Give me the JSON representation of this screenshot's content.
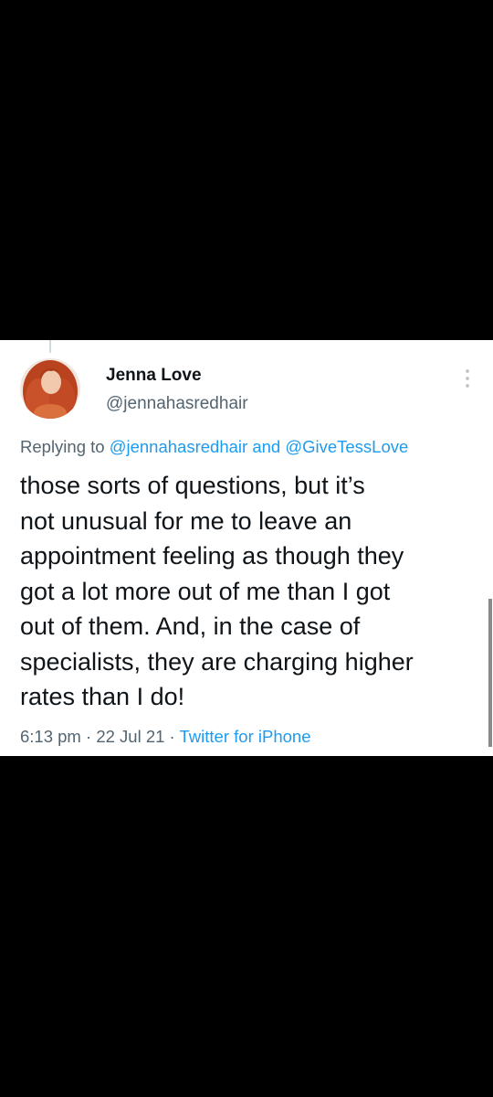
{
  "tweet": {
    "author": {
      "display_name": "Jenna Love",
      "handle": "@jennahasredhair",
      "avatar_icon": "profile-photo-red-hair"
    },
    "reply_prefix": "Replying to",
    "reply_to_1": "@jennahasredhair",
    "reply_joiner": "and",
    "reply_to_2": "@GiveTessLove",
    "text_lines": [
      "those sorts of questions, but it’s",
      "not unusual for me to leave an",
      "appointment feeling as though they",
      "got a lot more out of me than I got",
      "out of them. And, in the case of",
      "specialists, they are charging higher",
      "rates than I do!"
    ],
    "time": "6:13 pm",
    "separator": "·",
    "date": "22 Jul 21",
    "source": "Twitter for iPhone",
    "more_icon": "more-vertical-icon"
  },
  "colors": {
    "background": "#000000",
    "card": "#ffffff",
    "text": "#0f1419",
    "secondary": "#536471",
    "link": "#1d9bf0"
  }
}
